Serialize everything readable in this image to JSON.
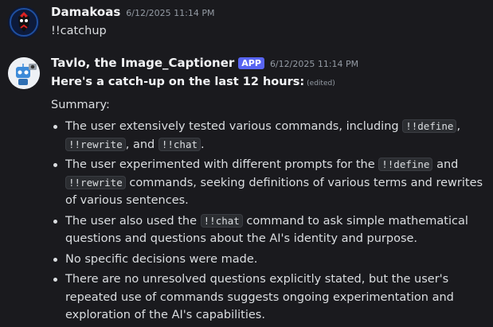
{
  "messages": [
    {
      "author": "Damakoas",
      "timestamp": "6/12/2025 11:14 PM",
      "text": "!!catchup"
    },
    {
      "author": "Tavlo, the Image_Captioner",
      "badge": "APP",
      "timestamp": "6/12/2025 11:14 PM",
      "heading": "Here's a catch-up on the last 12 hours:",
      "edited": "(edited)",
      "summary_label": "Summary:",
      "bullets": [
        {
          "parts": [
            "The user extensively tested various commands, including ",
            "!!define",
            ", ",
            "!!rewrite",
            ", and ",
            "!!chat",
            "."
          ]
        },
        {
          "parts": [
            "The user experimented with different prompts for the ",
            "!!define",
            " and ",
            "!!rewrite",
            " commands, seeking definitions of various terms and rewrites of various sentences."
          ]
        },
        {
          "parts": [
            "The user also used the ",
            "!!chat",
            " command to ask simple mathematical questions and questions about the AI's identity and purpose."
          ]
        },
        {
          "parts": [
            "No specific decisions were made."
          ]
        },
        {
          "parts": [
            "There are no unresolved questions explicitly stated, but the user's repeated use of commands suggests ongoing experimentation and exploration of the AI's capabilities."
          ]
        }
      ]
    }
  ],
  "colors": {
    "background": "#1a1a1e",
    "text": "#dbdee1",
    "username": "#f2f3f5",
    "timestamp": "#949ba4",
    "app_badge": "#5865f2",
    "code_bg": "#2b2d31"
  }
}
